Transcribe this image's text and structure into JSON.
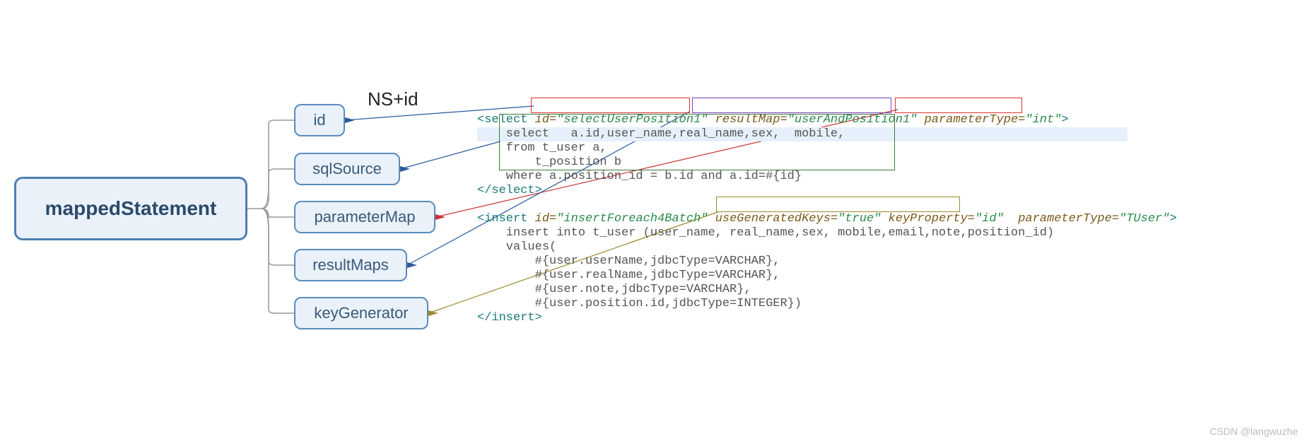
{
  "root": {
    "label": "mappedStatement"
  },
  "children": {
    "id": "id",
    "sqlSource": "sqlSource",
    "parameterMap": "parameterMap",
    "resultMaps": "resultMaps",
    "keyGenerator": "keyGenerator"
  },
  "nsLabel": "NS+id",
  "code": {
    "select": {
      "open": "<select",
      "id_attr": "id=",
      "id_val": "\"selectUserPosition1\"",
      "resultMap_attr": "resultMap=",
      "resultMap_val": "\"userAndPosition1\"",
      "paramType_attr": "parameterType=",
      "paramType_val": "\"int\"",
      "close": "</select>",
      "body1": "    select   a.id,user_name,real_name,sex,  mobile,",
      "body2": "    from t_user a,",
      "body3": "        t_position b",
      "body4": "    where a.position_id = b.id and a.id=#{id}"
    },
    "insert": {
      "open": "<insert",
      "id_attr": "id=",
      "id_val": "\"insertForeach4Batch\"",
      "useGen_attr": "useGeneratedKeys=",
      "useGen_val": "\"true\"",
      "keyProp_attr": "keyProperty=",
      "keyProp_val": "\"id\"",
      "paramType_attr": "parameterType=",
      "paramType_val": "\"TUser\"",
      "close": "</insert>",
      "body1": "    insert into t_user (user_name, real_name,sex, mobile,email,note,position_id)",
      "body2": "    values(",
      "body3": "        #{user.userName,jdbcType=VARCHAR},",
      "body4": "        #{user.realName,jdbcType=VARCHAR},",
      "body5": "        #{user.note,jdbcType=VARCHAR},",
      "body6": "        #{user.position.id,jdbcType=INTEGER})"
    }
  },
  "watermark": "CSDN @langwuzhe"
}
